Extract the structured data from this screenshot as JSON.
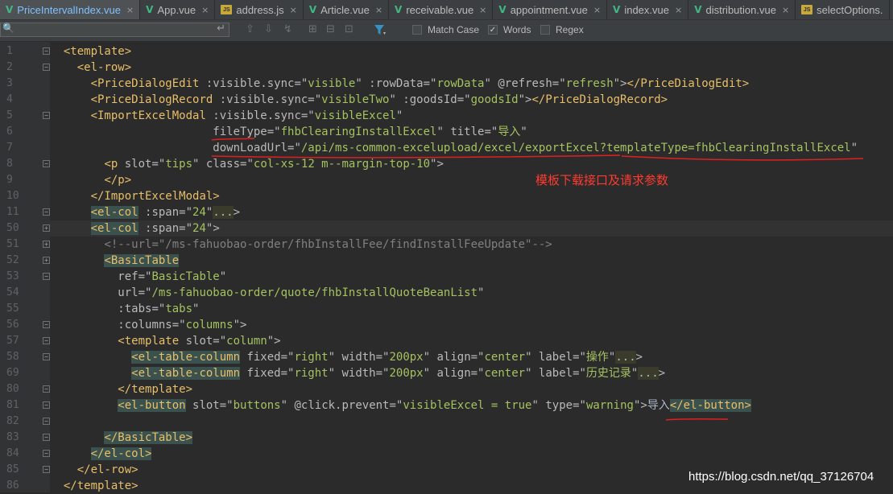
{
  "tabs": [
    {
      "label": "PriceIntervalIndex.vue",
      "type": "vue",
      "active": true
    },
    {
      "label": "App.vue",
      "type": "vue",
      "active": false
    },
    {
      "label": "address.js",
      "type": "js",
      "active": false
    },
    {
      "label": "Article.vue",
      "type": "vue",
      "active": false
    },
    {
      "label": "receivable.vue",
      "type": "vue",
      "active": false
    },
    {
      "label": "appointment.vue",
      "type": "vue",
      "active": false
    },
    {
      "label": "index.vue",
      "type": "vue",
      "active": false
    },
    {
      "label": "distribution.vue",
      "type": "vue",
      "active": false
    },
    {
      "label": "selectOptions.",
      "type": "js",
      "active": false
    }
  ],
  "icons": {
    "vue": "V",
    "js": "JS",
    "close": "×",
    "search": "🔍",
    "enter": "↵"
  },
  "search": {
    "value": "",
    "placeholder": ""
  },
  "options": {
    "match_case": {
      "label": "Match Case",
      "checked": false
    },
    "words": {
      "label": "Words",
      "checked": true
    },
    "regex": {
      "label": "Regex",
      "checked": false
    }
  },
  "line_numbers": [
    "1",
    "2",
    "3",
    "4",
    "5",
    "6",
    "7",
    "8",
    "9",
    "10",
    "11",
    "50",
    "51",
    "52",
    "53",
    "54",
    "55",
    "56",
    "57",
    "58",
    "69",
    "80",
    "81",
    "82",
    "83",
    "84",
    "85",
    "86"
  ],
  "folds": {
    "minus": [
      0,
      1,
      4,
      7,
      10,
      14,
      17,
      18,
      19,
      21,
      22,
      23,
      24,
      25,
      26
    ],
    "plus": [
      11,
      12,
      13
    ]
  },
  "code_lines": [
    [
      [
        "  ",
        ""
      ],
      [
        "<template>",
        "tag"
      ]
    ],
    [
      [
        "    ",
        ""
      ],
      [
        "<el-row>",
        "tag"
      ]
    ],
    [
      [
        "      ",
        ""
      ],
      [
        "<PriceDialogEdit",
        "tag"
      ],
      [
        " :visible.sync=\"",
        "att"
      ],
      [
        "visible",
        "str"
      ],
      [
        "\" :rowData=\"",
        "att"
      ],
      [
        "rowData",
        "str"
      ],
      [
        "\" @refresh=\"",
        "att"
      ],
      [
        "refresh",
        "str"
      ],
      [
        "\">",
        "att"
      ],
      [
        "</PriceDialogEdit>",
        "tag"
      ]
    ],
    [
      [
        "      ",
        ""
      ],
      [
        "<PriceDialogRecord",
        "tag"
      ],
      [
        " :visible.sync=\"",
        "att"
      ],
      [
        "visibleTwo",
        "str"
      ],
      [
        "\" :goodsId=\"",
        "att"
      ],
      [
        "goodsId",
        "str"
      ],
      [
        "\">",
        "att"
      ],
      [
        "</PriceDialogRecord>",
        "tag"
      ]
    ],
    [
      [
        "      ",
        ""
      ],
      [
        "<ImportExcelModal",
        "tag"
      ],
      [
        " :visible.sync=\"",
        "att"
      ],
      [
        "visibleExcel",
        "str"
      ],
      [
        "\"",
        "att"
      ]
    ],
    [
      [
        "                        ",
        ""
      ],
      [
        "fileType=\"",
        "att"
      ],
      [
        "fhbClearingInstallExcel",
        "str"
      ],
      [
        "\" title=\"",
        "att"
      ],
      [
        "导入",
        "str"
      ],
      [
        "\"",
        "att"
      ]
    ],
    [
      [
        "                        ",
        ""
      ],
      [
        "downLoadUrl=\"",
        "att"
      ],
      [
        "/api/ms-common-excelupload/excel/exportExcel?templateType=fhbClearingInstallExcel",
        "str"
      ],
      [
        "\"",
        "att"
      ]
    ],
    [
      [
        "        ",
        ""
      ],
      [
        "<p",
        "tag"
      ],
      [
        " slot=\"",
        "att"
      ],
      [
        "tips",
        "str"
      ],
      [
        "\" class=\"",
        "att"
      ],
      [
        "col-xs-12 m--margin-top-10",
        "str"
      ],
      [
        "\">",
        "att"
      ]
    ],
    [
      [
        "        ",
        ""
      ],
      [
        "</p>",
        "tag"
      ]
    ],
    [
      [
        "      ",
        ""
      ],
      [
        "</ImportExcelModal>",
        "tag"
      ]
    ],
    [
      [
        "      ",
        ""
      ],
      [
        "<el-col",
        "hl"
      ],
      [
        " :span=\"",
        "att"
      ],
      [
        "24",
        "str"
      ],
      [
        "\"",
        "att"
      ],
      [
        "...",
        "fd"
      ],
      [
        ">",
        "att"
      ]
    ],
    [
      [
        "      ",
        ""
      ],
      [
        "<el-col",
        "hl"
      ],
      [
        " :span=\"",
        "att"
      ],
      [
        "24",
        "str"
      ],
      [
        "\">",
        "att"
      ]
    ],
    [
      [
        "        ",
        ""
      ],
      [
        "<!--url=\"/ms-fahuobao-order/fhbInstallFee/findInstallFeeUpdate\"-->",
        "cmt"
      ]
    ],
    [
      [
        "        ",
        ""
      ],
      [
        "<BasicTable",
        "hl"
      ]
    ],
    [
      [
        "          ",
        ""
      ],
      [
        "ref=\"",
        "att"
      ],
      [
        "BasicTable",
        "str"
      ],
      [
        "\"",
        "att"
      ]
    ],
    [
      [
        "          ",
        ""
      ],
      [
        "url=\"",
        "att"
      ],
      [
        "/ms-fahuobao-order/quote/fhbInstallQuoteBeanList",
        "str"
      ],
      [
        "\"",
        "att"
      ]
    ],
    [
      [
        "          ",
        ""
      ],
      [
        ":tabs=\"",
        "att"
      ],
      [
        "tabs",
        "str"
      ],
      [
        "\"",
        "att"
      ]
    ],
    [
      [
        "          ",
        ""
      ],
      [
        ":columns=\"",
        "att"
      ],
      [
        "columns",
        "str"
      ],
      [
        "\">",
        "att"
      ]
    ],
    [
      [
        "          ",
        ""
      ],
      [
        "<template",
        "tag"
      ],
      [
        " slot=\"",
        "att"
      ],
      [
        "column",
        "str"
      ],
      [
        "\">",
        "att"
      ]
    ],
    [
      [
        "            ",
        ""
      ],
      [
        "<el-table-column",
        "hl"
      ],
      [
        " fixed=\"",
        "att"
      ],
      [
        "right",
        "str"
      ],
      [
        "\" width=\"",
        "att"
      ],
      [
        "200px",
        "str"
      ],
      [
        "\" align=\"",
        "att"
      ],
      [
        "center",
        "str"
      ],
      [
        "\" label=\"",
        "att"
      ],
      [
        "操作",
        "str"
      ],
      [
        "\"",
        "att"
      ],
      [
        "...",
        "fd"
      ],
      [
        ">",
        "att"
      ]
    ],
    [
      [
        "            ",
        ""
      ],
      [
        "<el-table-column",
        "hl"
      ],
      [
        " fixed=\"",
        "att"
      ],
      [
        "right",
        "str"
      ],
      [
        "\" width=\"",
        "att"
      ],
      [
        "200px",
        "str"
      ],
      [
        "\" align=\"",
        "att"
      ],
      [
        "center",
        "str"
      ],
      [
        "\" label=\"",
        "att"
      ],
      [
        "历史记录",
        "str"
      ],
      [
        "\"",
        "att"
      ],
      [
        "...",
        "fd"
      ],
      [
        ">",
        "att"
      ]
    ],
    [
      [
        "          ",
        ""
      ],
      [
        "</template>",
        "tag"
      ]
    ],
    [
      [
        "          ",
        ""
      ],
      [
        "<el-button",
        "hl"
      ],
      [
        " slot=\"",
        "att"
      ],
      [
        "buttons",
        "str"
      ],
      [
        "\" @click.prevent=\"",
        "att"
      ],
      [
        "visibleExcel = true",
        "str"
      ],
      [
        "\" type=\"",
        "att"
      ],
      [
        "warning",
        "str"
      ],
      [
        "\">",
        "att"
      ],
      [
        "导入",
        ""
      ],
      [
        "</el-button>",
        "hl"
      ]
    ],
    [
      [
        "",
        ""
      ]
    ],
    [
      [
        "        ",
        ""
      ],
      [
        "</BasicTable>",
        "hl"
      ]
    ],
    [
      [
        "      ",
        ""
      ],
      [
        "</el-col>",
        "hl"
      ]
    ],
    [
      [
        "    ",
        ""
      ],
      [
        "</el-row>",
        "tag"
      ]
    ],
    [
      [
        "  ",
        ""
      ],
      [
        "</template>",
        "tag"
      ]
    ]
  ],
  "annotation": "模板下载接口及请求参数",
  "watermark": "https://blog.csdn.net/qq_37126704",
  "colors": {
    "annotation": "#ff3b30",
    "tag": "#e8bf6a",
    "string": "#a5c261",
    "attribute": "#bababa",
    "comment": "#808080"
  }
}
